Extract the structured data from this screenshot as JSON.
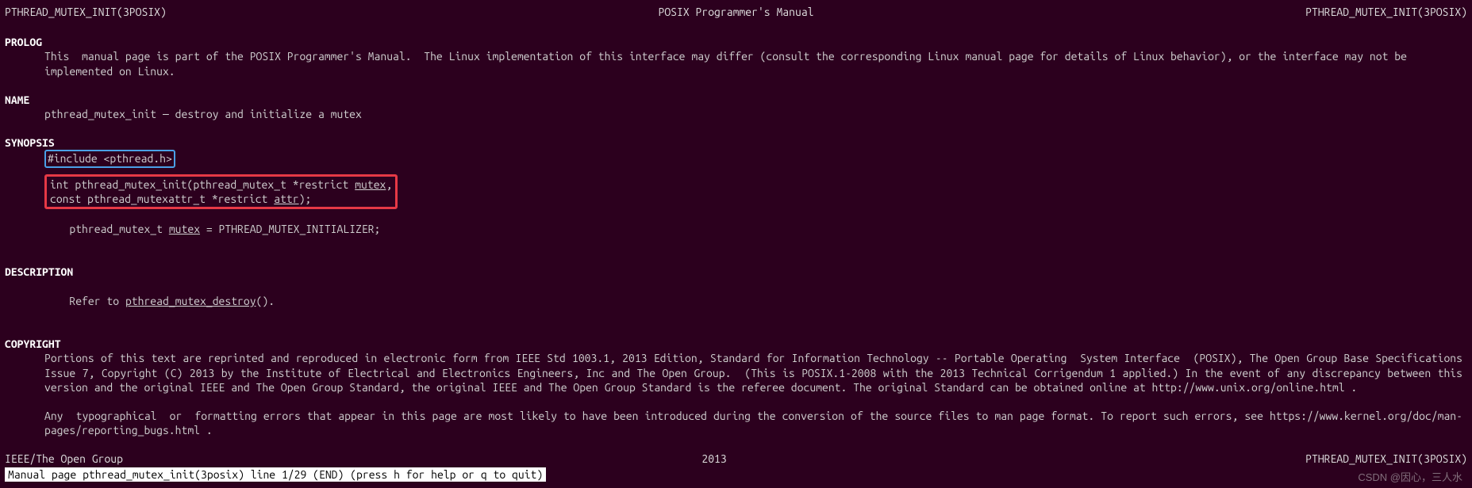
{
  "header": {
    "left": "PTHREAD_MUTEX_INIT(3POSIX)",
    "center": "POSIX Programmer's Manual",
    "right": "PTHREAD_MUTEX_INIT(3POSIX)"
  },
  "sections": {
    "prolog": {
      "heading": "PROLOG",
      "text": "This  manual page is part of the POSIX Programmer's Manual.  The Linux implementation of this interface may differ (consult the corresponding Linux manual page for details of Linux behavior), or the interface may not be implemented on Linux."
    },
    "name": {
      "heading": "NAME",
      "text": "pthread_mutex_init — destroy and initialize a mutex"
    },
    "synopsis": {
      "heading": "SYNOPSIS",
      "include": "#include <pthread.h>",
      "func_line1_pre": "int pthread_mutex_init(pthread_mutex_t *restrict ",
      "func_line1_mutex": "mutex",
      "func_line1_post": ",",
      "func_line2_pre": "    const pthread_mutexattr_t *restrict ",
      "func_line2_attr": "attr",
      "func_line2_post": ");",
      "init_pre": "pthread_mutex_t ",
      "init_mutex": "mutex",
      "init_post": " = PTHREAD_MUTEX_INITIALIZER;"
    },
    "description": {
      "heading": "DESCRIPTION",
      "pre": "Refer to ",
      "link": "pthread_mutex_destroy",
      "post": "()."
    },
    "copyright": {
      "heading": "COPYRIGHT",
      "para1": "Portions of this text are reprinted and reproduced in electronic form from IEEE Std 1003.1, 2013 Edition, Standard for Information Technology -- Portable Operating  System Interface  (POSIX), The Open Group Base Specifications Issue 7, Copyright (C) 2013 by the Institute of Electrical and Electronics Engineers, Inc and The Open Group.  (This is POSIX.1-2008 with the 2013 Technical Corrigendum 1 applied.) In the event of any discrepancy between this version and the original IEEE and The Open Group Standard, the original IEEE and The Open Group Standard is the referee document. The original Standard can be obtained online at http://www.unix.org/online.html .",
      "para2": "Any  typographical  or  formatting errors that appear in this page are most likely to have been introduced during the conversion of the source files to man page format. To report such errors, see https://www.kernel.org/doc/man-pages/reporting_bugs.html ."
    }
  },
  "footer": {
    "left": "IEEE/The Open Group",
    "center": "2013",
    "right": "PTHREAD_MUTEX_INIT(3POSIX)"
  },
  "status": " Manual page pthread_mutex_init(3posix) line 1/29 (END) (press h for help or q to quit)",
  "watermark": "CSDN @因心，三人水"
}
